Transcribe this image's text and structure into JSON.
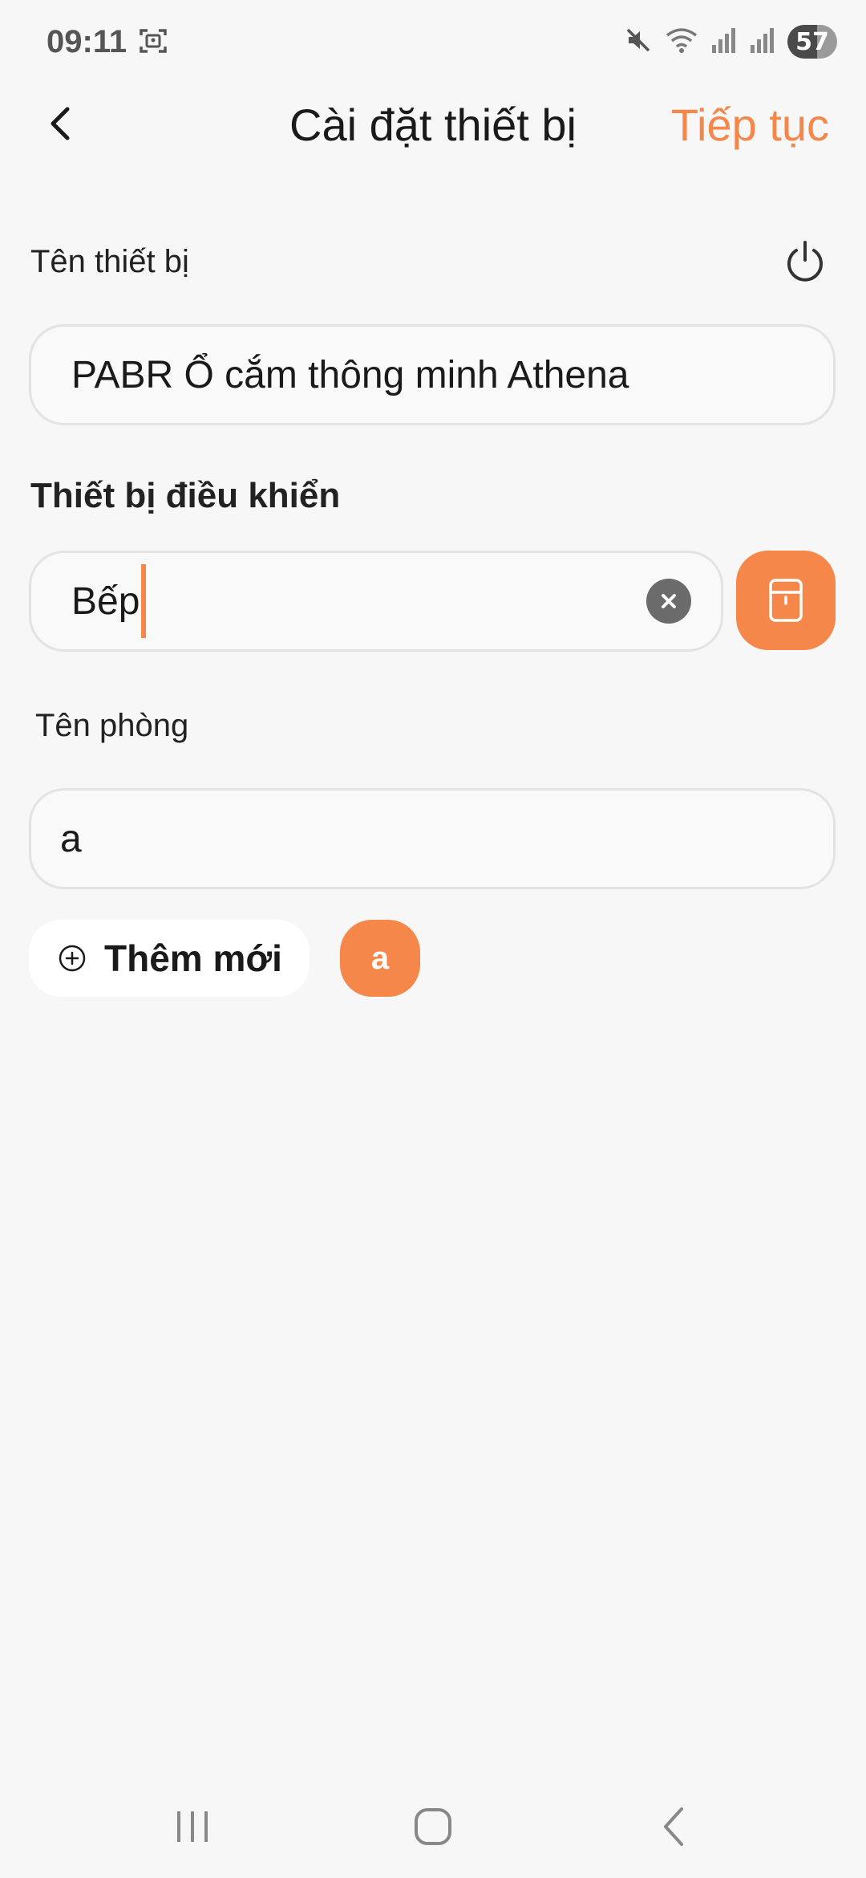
{
  "status_bar": {
    "time": "09:11",
    "battery": "57"
  },
  "header": {
    "title": "Cài đặt thiết bị",
    "continue_label": "Tiếp tục"
  },
  "device_name": {
    "label": "Tên thiết bị",
    "value": "PABR Ổ cắm thông minh Athena"
  },
  "controller": {
    "label": "Thiết bị điều khiển",
    "value": "Bếp"
  },
  "room": {
    "label": "Tên phòng",
    "value": "a",
    "add_new_label": "Thêm mới",
    "chips": [
      "a"
    ]
  },
  "colors": {
    "accent": "#f5874a",
    "background": "#f7f7f7"
  }
}
